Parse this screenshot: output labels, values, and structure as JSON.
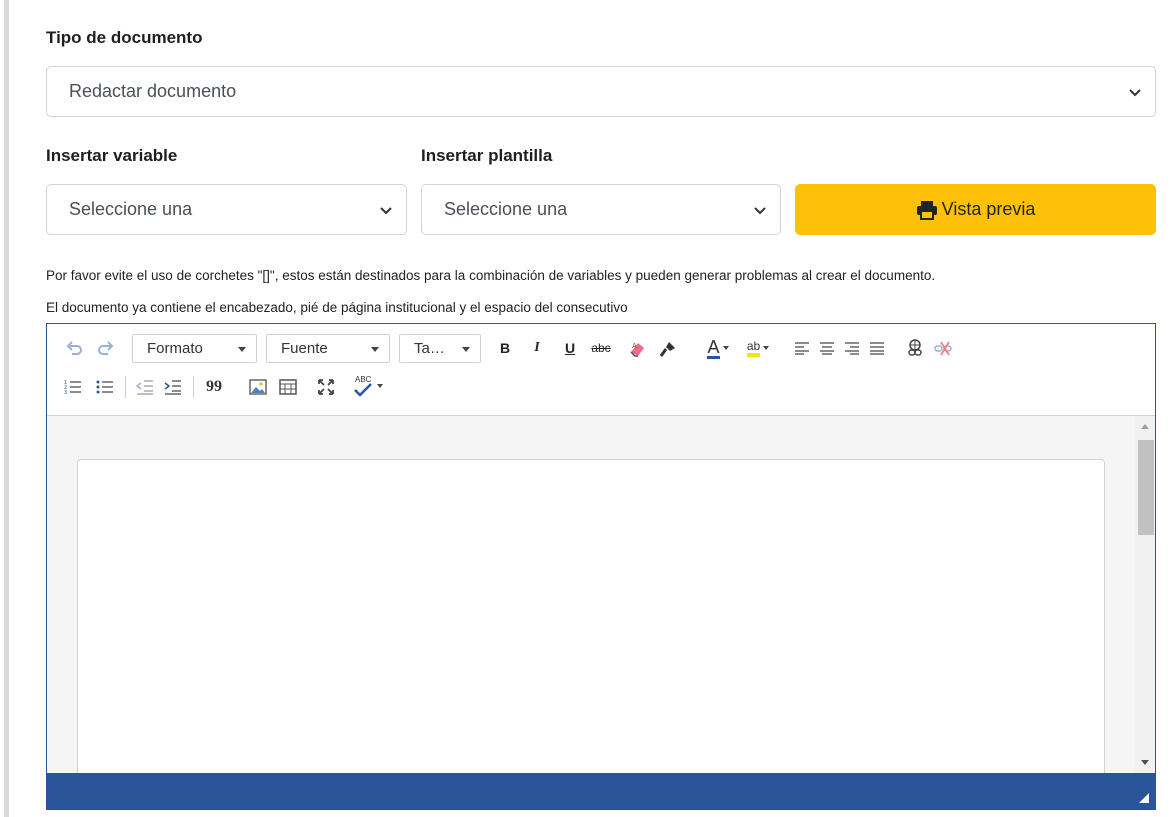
{
  "form": {
    "doc_type_label": "Tipo de documento",
    "doc_type_value": "Redactar documento",
    "insert_variable_label": "Insertar variable",
    "insert_variable_value": "Seleccione una",
    "insert_template_label": "Insertar plantilla",
    "insert_template_value": "Seleccione una",
    "preview_button": "Vista previa",
    "note_brackets": "Por favor evite el uso de corchetes \"[]\", estos están destinados para la combinación de variables y pueden generar problemas al crear el documento.",
    "note_header": "El documento ya contiene el encabezado, pié de página institucional y el espacio del consecutivo"
  },
  "editor": {
    "format_combo": "Formato",
    "font_combo": "Fuente",
    "size_combo": "Ta…",
    "bold": "B",
    "italic": "I",
    "underline": "U",
    "strike": "abc",
    "text_color": "A",
    "bg_color": "ab",
    "quote": "99",
    "spell_check": "ABC"
  },
  "colors": {
    "accent_yellow": "#ffc107",
    "editor_blue": "#2c5599"
  }
}
